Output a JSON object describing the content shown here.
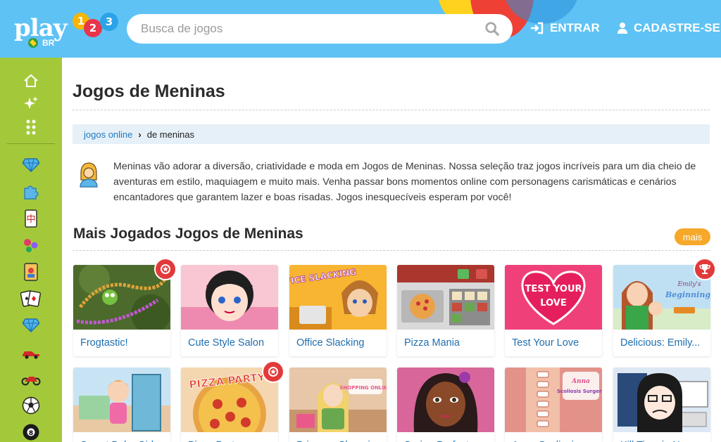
{
  "header": {
    "logo_text": "play",
    "logo_digits": [
      "1",
      "2",
      "3"
    ],
    "country": "BR",
    "search_placeholder": "Busca de jogos",
    "login_label": "ENTRAR",
    "signup_label": "CADASTRE-SE"
  },
  "sidebar": {
    "items": [
      "home-icon",
      "sparkles-icon",
      "grid-dots-icon",
      "diamond-icon",
      "puzzle-icon",
      "mahjong-tile-icon",
      "bubbles-icon",
      "card-game-icon",
      "playing-cards-icon",
      "diamond-icon",
      "car-icon",
      "motorbike-icon",
      "soccer-ball-icon",
      "billiard-ball-icon"
    ]
  },
  "main": {
    "title": "Jogos de Meninas",
    "breadcrumb": {
      "home": "jogos online",
      "current": "de meninas"
    },
    "intro": "Meninas vão adorar a diversão, criatividade e moda em Jogos de Meninas. Nossa seleção traz jogos incríveis para um dia cheio de aventuras em estilo, maquiagem e muito mais. Venha passar bons momentos online com personagens carismáticas e cenários encantadores que garantem lazer e boas risadas. Jogos inesquecíveis esperam por você!",
    "section_title": "Mais Jogados Jogos de Meninas",
    "more_label": "mais",
    "games_row1": [
      {
        "title": "Frogtastic!",
        "badge": "award-icon"
      },
      {
        "title": "Cute Style Salon",
        "badge": ""
      },
      {
        "title": "Office Slacking",
        "badge": ""
      },
      {
        "title": "Pizza Mania",
        "badge": ""
      },
      {
        "title": "Test Your Love",
        "badge": ""
      },
      {
        "title": "Delicious: Emily...",
        "badge": "trophy-icon"
      }
    ],
    "games_row2": [
      {
        "title": "Sweet Baby Girl",
        "badge": ""
      },
      {
        "title": "Pizza Party",
        "badge": "award-icon"
      },
      {
        "title": "Princess Shopping",
        "badge": ""
      },
      {
        "title": "Spring Perfect",
        "badge": ""
      },
      {
        "title": "Anna Scoliosis",
        "badge": ""
      },
      {
        "title": "Kill Time in N...",
        "badge": ""
      }
    ],
    "thumb_texts": {
      "office": "OFFICE SLACKING",
      "love": "TEST YOUR LOVE",
      "emily_small": "Emily's",
      "emily_big": "New Beginning",
      "pizza_party": "PIZZA PARTY",
      "princess": "SHOPPING ONLINE",
      "anna": "Scoliosis Surgery"
    }
  }
}
